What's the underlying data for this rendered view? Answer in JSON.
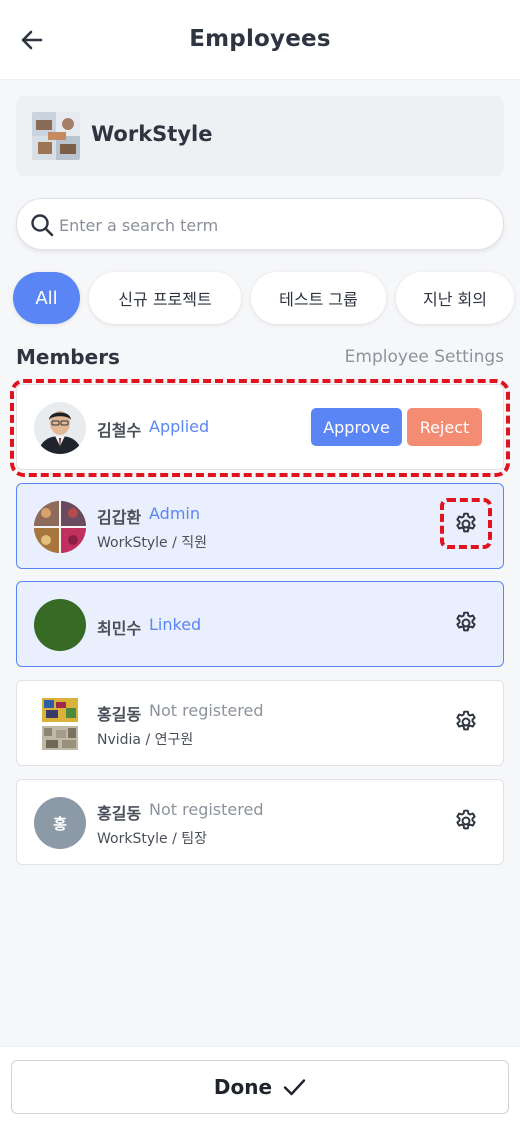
{
  "header": {
    "title": "Employees",
    "back_icon": "arrow-left-icon"
  },
  "company": {
    "name": "WorkStyle"
  },
  "search": {
    "placeholder": "Enter a search term",
    "value": ""
  },
  "filters": [
    {
      "label": "All",
      "active": true
    },
    {
      "label": "신규 프로젝트",
      "active": false
    },
    {
      "label": "테스트 그룹",
      "active": false
    },
    {
      "label": "지난 회의",
      "active": false
    }
  ],
  "members_section": {
    "title": "Members",
    "settings_link": "Employee Settings"
  },
  "members": [
    {
      "name": "김철수",
      "status": "Applied",
      "approve_label": "Approve",
      "reject_label": "Reject"
    },
    {
      "name": "김갑환",
      "status": "Admin",
      "company": "WorkStyle",
      "role": "직원"
    },
    {
      "name": "최민수",
      "status": "Linked"
    },
    {
      "name": "홍길동",
      "status": "Not registered",
      "company": "Nvidia",
      "role": "연구원"
    },
    {
      "name": "홍길동",
      "status": "Not registered",
      "company": "WorkStyle",
      "role": "팀장",
      "initial": "홍"
    }
  ],
  "footer": {
    "done_label": "Done"
  },
  "colors": {
    "accent": "#5a86f5",
    "reject": "#f48c74",
    "highlight": "#e0131f",
    "linked_avatar": "#366a25",
    "initial_avatar": "#8c99a6"
  }
}
